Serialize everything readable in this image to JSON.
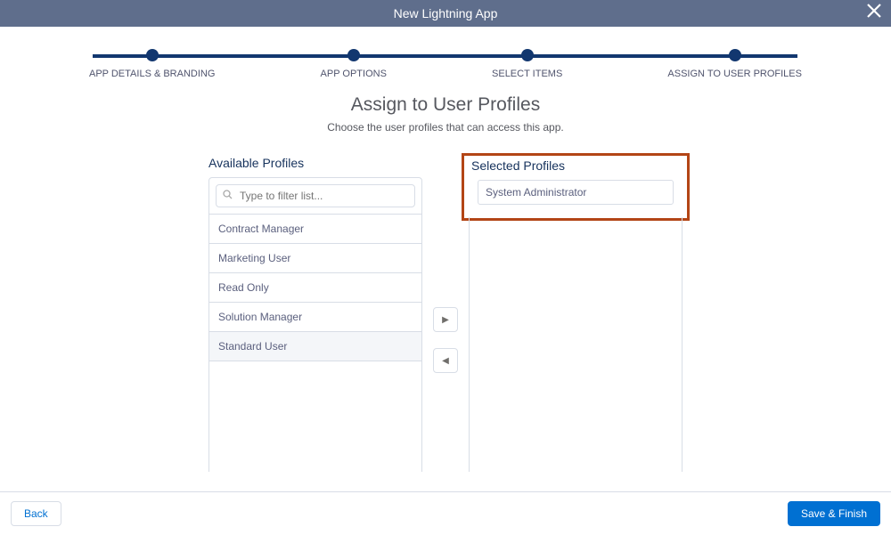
{
  "header": {
    "title": "New Lightning App"
  },
  "progress": [
    {
      "label": "APP DETAILS & BRANDING"
    },
    {
      "label": "APP OPTIONS"
    },
    {
      "label": "SELECT ITEMS"
    },
    {
      "label": "ASSIGN TO USER PROFILES"
    }
  ],
  "step": {
    "title": "Assign to User Profiles",
    "subtitle": "Choose the user profiles that can access this app."
  },
  "available": {
    "title": "Available Profiles",
    "searchPlaceholder": "Type to filter list...",
    "items": [
      {
        "label": "Contract Manager"
      },
      {
        "label": "Marketing User"
      },
      {
        "label": "Read Only"
      },
      {
        "label": "Solution Manager"
      },
      {
        "label": "Standard User"
      }
    ]
  },
  "selected": {
    "title": "Selected Profiles",
    "items": [
      {
        "label": "System Administrator"
      }
    ]
  },
  "footer": {
    "back": "Back",
    "save": "Save & Finish"
  }
}
